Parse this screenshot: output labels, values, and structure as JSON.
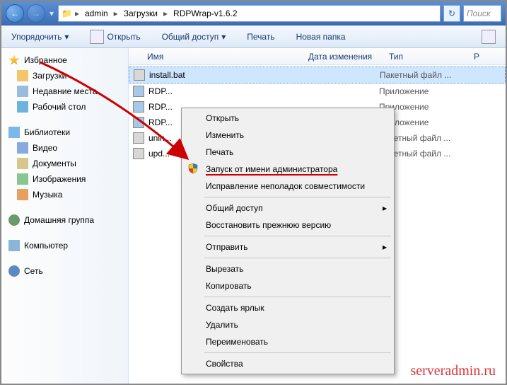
{
  "nav": {
    "back": "←",
    "forward": "→",
    "dropdown": "▾",
    "refresh": "↻"
  },
  "breadcrumb": {
    "root_icon": "📁",
    "items": [
      "admin",
      "Загрузки",
      "RDPWrap-v1.6.2"
    ]
  },
  "search": {
    "placeholder": "Поиск"
  },
  "toolbar": {
    "organize": "Упорядочить",
    "open": "Открыть",
    "share": "Общий доступ",
    "print": "Печать",
    "newfolder": "Новая папка"
  },
  "sidebar": {
    "favorites": {
      "title": "Избранное",
      "items": [
        "Загрузки",
        "Недавние места",
        "Рабочий стол"
      ]
    },
    "libraries": {
      "title": "Библиотеки",
      "items": [
        "Видео",
        "Документы",
        "Изображения",
        "Музыка"
      ]
    },
    "homegroup": {
      "title": "Домашняя группа"
    },
    "computer": {
      "title": "Компьютер"
    },
    "network": {
      "title": "Сеть"
    }
  },
  "columns": {
    "name": "Имя",
    "date": "Дата изменения",
    "type": "Тип",
    "size": "Р"
  },
  "files": [
    {
      "name": "install.bat",
      "date": "",
      "type": "Пакетный файл ..."
    },
    {
      "name": "RDP...",
      "date": "",
      "type": "Приложение"
    },
    {
      "name": "RDP...",
      "date": "",
      "type": "Приложение"
    },
    {
      "name": "RDP...",
      "date": "",
      "type": "Приложение"
    },
    {
      "name": "unin...",
      "date": "",
      "type": "Пакетный файл ..."
    },
    {
      "name": "upd...",
      "date": "",
      "type": "Пакетный файл ..."
    }
  ],
  "context": [
    {
      "label": "Открыть"
    },
    {
      "label": "Изменить"
    },
    {
      "label": "Печать"
    },
    {
      "label": "Запуск от имени администратора",
      "shield": true,
      "highlight": true
    },
    {
      "label": "Исправление неполадок совместимости"
    },
    {
      "sep": true
    },
    {
      "label": "Общий доступ",
      "sub": true
    },
    {
      "label": "Восстановить прежнюю версию"
    },
    {
      "sep": true
    },
    {
      "label": "Отправить",
      "sub": true
    },
    {
      "sep": true
    },
    {
      "label": "Вырезать"
    },
    {
      "label": "Копировать"
    },
    {
      "sep": true
    },
    {
      "label": "Создать ярлык"
    },
    {
      "label": "Удалить"
    },
    {
      "label": "Переименовать"
    },
    {
      "sep": true
    },
    {
      "label": "Свойства"
    }
  ],
  "watermark": "serveradmin.ru"
}
